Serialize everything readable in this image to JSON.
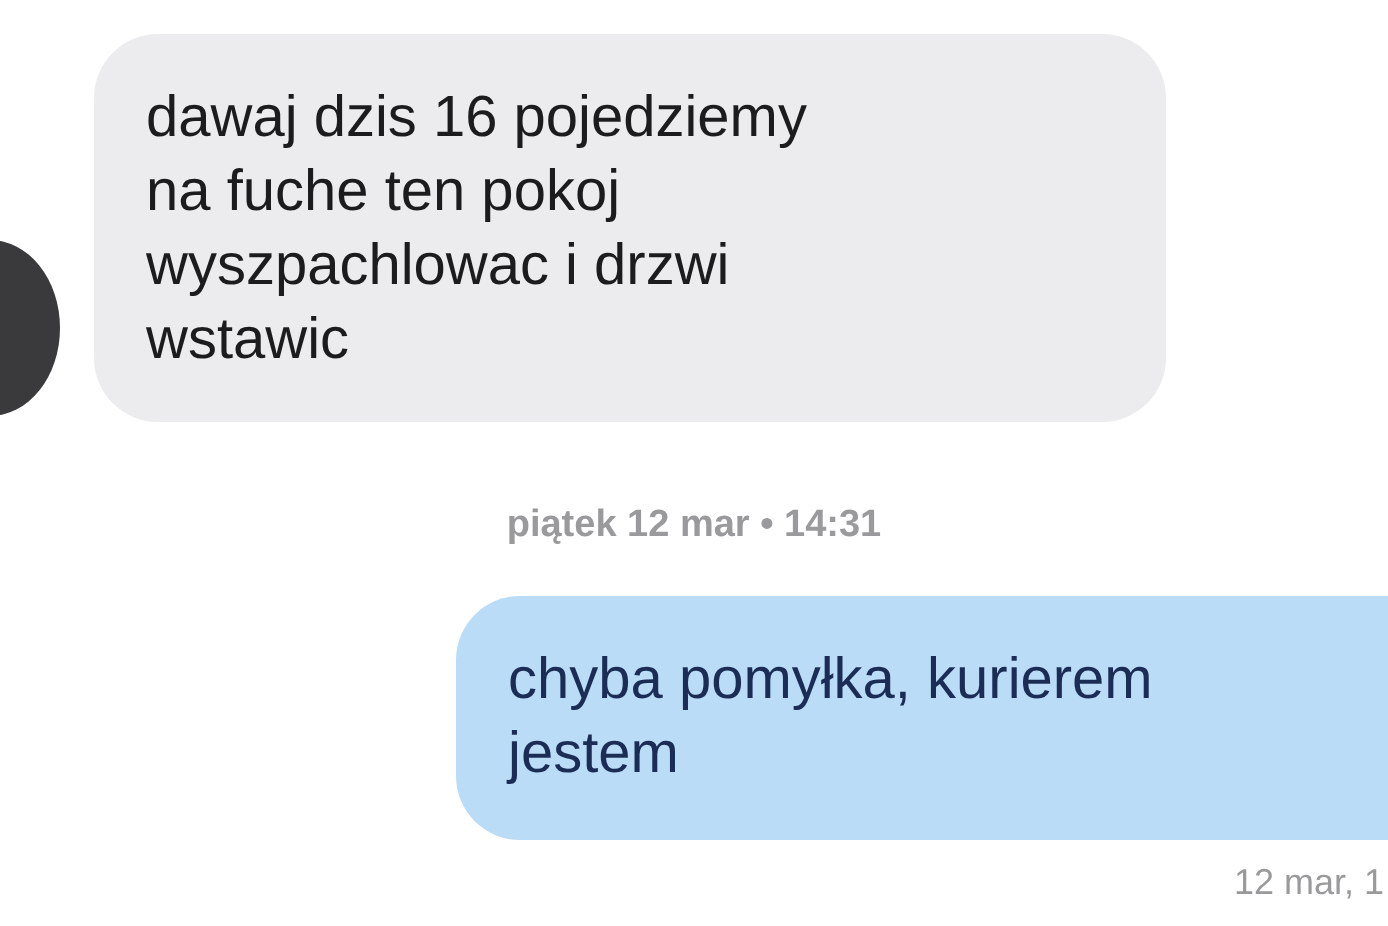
{
  "messages": [
    {
      "kind": "incoming",
      "text": "dawaj dzis 16 pojedziemy\nna fuche ten pokoj\nwyszpachlowac i drzwi\nwstawic"
    },
    {
      "kind": "timestamp",
      "text": "piątek 12 mar • 14:31"
    },
    {
      "kind": "outgoing",
      "text": "chyba pomyłka, kurierem\njestem"
    },
    {
      "kind": "meta",
      "text": "12 mar, 1"
    }
  ]
}
